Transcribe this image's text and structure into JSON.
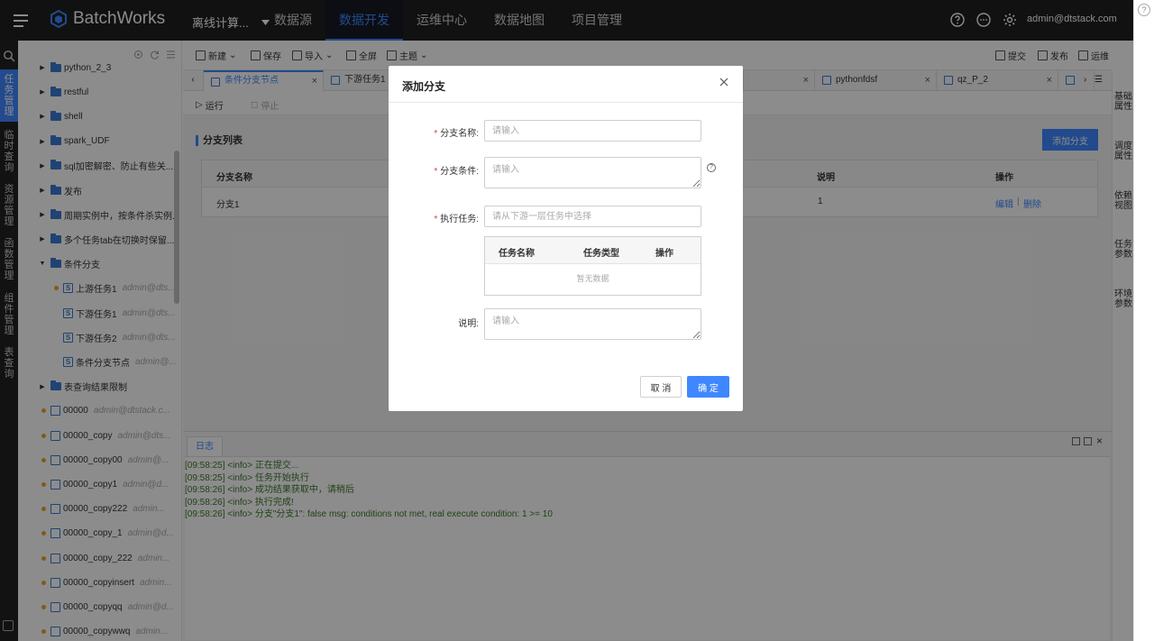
{
  "app": {
    "name": "BatchWorks",
    "project": "离线计算...",
    "user": "admin@dtstack.com"
  },
  "nav": [
    "数据源",
    "数据开发",
    "运维中心",
    "数据地图",
    "项目管理"
  ],
  "left_menu": [
    "任务管理",
    "临时查询",
    "资源管理",
    "函数管理",
    "组件管理",
    "表查询"
  ],
  "tree": [
    {
      "label": "python_2_3",
      "kind": "folder"
    },
    {
      "label": "restful",
      "kind": "folder"
    },
    {
      "label": "shell",
      "kind": "folder"
    },
    {
      "label": "spark_UDF",
      "kind": "folder"
    },
    {
      "label": "sql加密解密、防止有些关...",
      "kind": "folder"
    },
    {
      "label": "发布",
      "kind": "folder"
    },
    {
      "label": "周期实例中，按条件杀实例...",
      "kind": "folder"
    },
    {
      "label": "多个任务tab在切换时保留...",
      "kind": "folder"
    },
    {
      "label": "条件分支",
      "kind": "folder-open"
    },
    {
      "label": "上游任务1",
      "owner": "admin@dts...",
      "kind": "task-dot"
    },
    {
      "label": "下游任务1",
      "owner": "admin@dts...",
      "kind": "task"
    },
    {
      "label": "下游任务2",
      "owner": "admin@dts...",
      "kind": "task"
    },
    {
      "label": "条件分支节点",
      "owner": "admin@...",
      "kind": "task"
    },
    {
      "label": "表查询结果限制",
      "kind": "folder"
    },
    {
      "label": "00000",
      "owner": "admin@dtstack.c...",
      "kind": "root"
    },
    {
      "label": "00000_copy",
      "owner": "admin@dts...",
      "kind": "root"
    },
    {
      "label": "00000_copy00",
      "owner": "admin@...",
      "kind": "root"
    },
    {
      "label": "00000_copy1",
      "owner": "admin@d...",
      "kind": "root"
    },
    {
      "label": "00000_copy222",
      "owner": "admin...",
      "kind": "root"
    },
    {
      "label": "00000_copy_1",
      "owner": "admin@d...",
      "kind": "root"
    },
    {
      "label": "00000_copy_222",
      "owner": "admin...",
      "kind": "root"
    },
    {
      "label": "00000_copyinsert",
      "owner": "admin...",
      "kind": "root"
    },
    {
      "label": "00000_copyqq",
      "owner": "admin@d...",
      "kind": "root"
    },
    {
      "label": "00000_copywwq",
      "owner": "admin...",
      "kind": "root"
    }
  ],
  "toolbar": {
    "new": "新建",
    "save": "保存",
    "import": "导入",
    "fullscreen": "全屏",
    "theme": "主题",
    "submit": "提交",
    "publish": "发布",
    "ops": "运维"
  },
  "tabs": [
    "条件分支节点",
    "下游任务1",
    "pythonfdsf",
    "qz_P_2"
  ],
  "run": {
    "run": "运行",
    "stop": "停止"
  },
  "branch": {
    "section_title": "分支列表",
    "add_button": "添加分支",
    "headers": [
      "分支名称",
      "说明",
      "操作"
    ],
    "rows": [
      {
        "name": "分支1",
        "desc": "1",
        "edit": "编辑",
        "sep": "|",
        "delete": "删除"
      }
    ]
  },
  "right_tabs": [
    "基础属性",
    "调度属性",
    "依赖视图",
    "任务参数",
    "环境参数"
  ],
  "log": {
    "tab": "日志",
    "lines": [
      "[09:58:25] <info> 正在提交...",
      "[09:58:25] <info> 任务开始执行",
      "[09:58:26] <info> 成功结果获取中，请稍后",
      "[09:58:26] <info> 执行完成!",
      "[09:58:26] <info> 分支\"分支1\": false msg: conditions not met, real execute condition: 1 >= 10"
    ]
  },
  "modal": {
    "title": "添加分支",
    "name_label": "分支名称:",
    "name_placeholder": "请输入",
    "cond_label": "分支条件:",
    "cond_placeholder": "请输入",
    "task_label": "执行任务:",
    "task_placeholder": "请从下游一层任务中选择",
    "task_headers": [
      "任务名称",
      "任务类型",
      "操作"
    ],
    "empty": "暂无数据",
    "desc_label": "说明:",
    "desc_placeholder": "请输入",
    "cancel": "取 消",
    "ok": "确 定"
  },
  "colors": {
    "accent": "#3f87ff",
    "topbar": "#1f1f1f",
    "required": "#e33333",
    "log_text": "#3a7a28"
  }
}
